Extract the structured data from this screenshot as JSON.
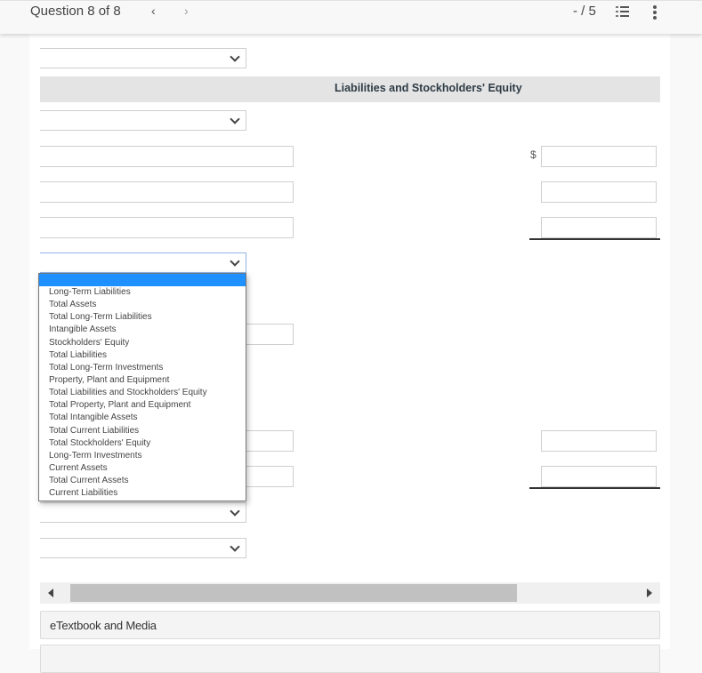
{
  "topbar": {
    "question_label": "Question 8 of 8",
    "prev_icon": "chevron-left-icon",
    "next_icon": "chevron-right-icon",
    "score": "- / 5",
    "list_icon": "numbered-list-icon",
    "more_icon": "vertical-ellipsis-icon"
  },
  "section": {
    "header_title": "Liabilities and Stockholders' Equity"
  },
  "currency_symbol": "$",
  "selects": [
    {
      "value": ""
    },
    {
      "value": ""
    },
    {
      "value": "",
      "state": "open"
    },
    {
      "value": ""
    },
    {
      "value": ""
    }
  ],
  "text_inputs": [
    {
      "value": ""
    },
    {
      "value": ""
    },
    {
      "value": ""
    },
    {
      "value": ""
    },
    {
      "value": ""
    },
    {
      "value": ""
    }
  ],
  "amount_inputs": [
    {
      "value": ""
    },
    {
      "value": ""
    },
    {
      "value": ""
    },
    {
      "value": ""
    },
    {
      "value": ""
    }
  ],
  "dropdown": {
    "highlighted_option": "",
    "options": [
      "Long-Term Liabilities",
      "Total Assets",
      "Total Long-Term Liabilities",
      "Intangible Assets",
      "Stockholders' Equity",
      "Total Liabilities",
      "Total Long-Term Investments",
      "Property, Plant and Equipment",
      "Total Liabilities and Stockholders' Equity",
      "Total Property, Plant and Equipment",
      "Total Intangible Assets",
      "Total Current Liabilities",
      "Total Stockholders' Equity",
      "Long-Term Investments",
      "Current Assets",
      "Total Current Assets",
      "Current Liabilities"
    ]
  },
  "scrollbar": {
    "position_fraction": 0,
    "visible_fraction": 0.75
  },
  "panels": [
    {
      "label": "eTextbook and Media"
    },
    {
      "label": ""
    }
  ],
  "colors": {
    "highlight": "#1e90ff",
    "header_band": "#e4e4e4"
  }
}
